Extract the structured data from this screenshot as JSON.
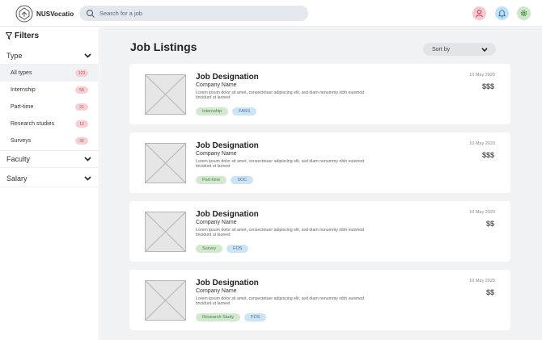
{
  "brand": {
    "name": "NUSVocatio"
  },
  "search": {
    "placeholder": "Search for a job"
  },
  "colors": {
    "accent_pink": "#f7c9cc",
    "accent_blue": "#bfe0f7",
    "accent_green": "#cde8c9",
    "tag_green": "#d2e9cf",
    "tag_blue": "#cde4f4"
  },
  "icons": {
    "user": "user-icon",
    "bell": "bell-icon",
    "settings": "gear-icon",
    "search": "search-icon",
    "filter": "filter-icon",
    "chevron": "chevron-down-icon"
  },
  "sidebar": {
    "title": "Filters",
    "sections": [
      {
        "label": "Type"
      },
      {
        "label": "Faculty"
      },
      {
        "label": "Salary"
      }
    ],
    "type_items": [
      {
        "label": "All types",
        "count": "123",
        "active": true
      },
      {
        "label": "Internship",
        "count": "58"
      },
      {
        "label": "Part-time",
        "count": "21"
      },
      {
        "label": "Research studies",
        "count": "12"
      },
      {
        "label": "Surveys",
        "count": "32"
      }
    ]
  },
  "main": {
    "title": "Job Listings",
    "sort_label": "Sort by",
    "jobs": [
      {
        "title": "Job Designation",
        "company": "Company Name",
        "description": "Lorem ipsum dolor sit amet, consectetuer adipiscing elit, sed diam nonummy nibh euismod tincidunt ut laoreet",
        "type_tag": "Internship",
        "faculty_tag": "FASS",
        "date": "10 May 2020",
        "pay": "$$$"
      },
      {
        "title": "Job Designation",
        "company": "Company Name",
        "description": "Lorem ipsum dolor sit amet, consectetuer adipiscing elit, sed diam nonummy nibh euismod tincidunt ut laoreet",
        "type_tag": "Part-time",
        "faculty_tag": "SOC",
        "date": "10 May 2020",
        "pay": "$$$"
      },
      {
        "title": "Job Designation",
        "company": "Company Name",
        "description": "Lorem ipsum dolor sit amet, consectetuer adipiscing elit, sed diam nonummy nibh euismod tincidunt ut laoreet",
        "type_tag": "Survey",
        "faculty_tag": "FOS",
        "date": "10 May 2020",
        "pay": "$$"
      },
      {
        "title": "Job Designation",
        "company": "Company Name",
        "description": "Lorem ipsum dolor sit amet, consectetuer adipiscing elit, sed diam nonummy nibh euismod tincidunt ut laoreet",
        "type_tag": "Research Study",
        "faculty_tag": "FOS",
        "date": "10 May 2020",
        "pay": "$$"
      }
    ]
  }
}
